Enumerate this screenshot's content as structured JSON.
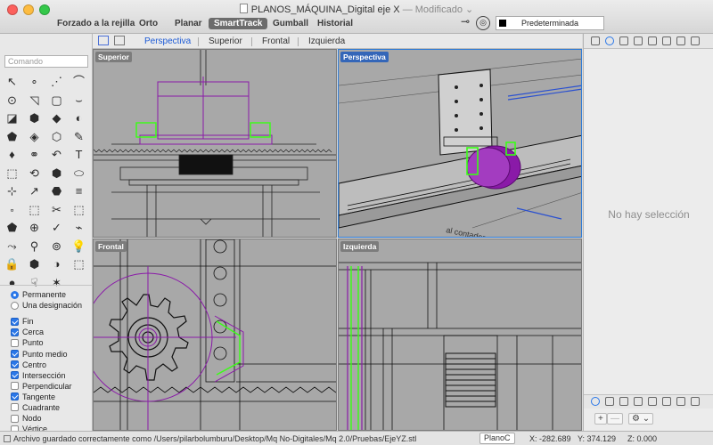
{
  "window": {
    "title": "PLANOS_MÁQUINA_Digital eje X",
    "modified": "— Modificado",
    "modified_arrow": "⌄"
  },
  "toolbar": {
    "buttons": [
      "Forzado a la rejilla",
      "Orto",
      "Planar",
      "SmartTrack",
      "Gumball",
      "Historial"
    ],
    "active": "SmartTrack",
    "layer_name": "Predeterminada"
  },
  "viewport_tabs": {
    "tabs": [
      "Perspectiva",
      "Superior",
      "Frontal",
      "Izquierda"
    ],
    "active": "Perspectiva"
  },
  "viewports": {
    "superior": "Superior",
    "perspectiva": "Perspectiva",
    "frontal": "Frontal",
    "izquierda": "Izquierda"
  },
  "command": {
    "placeholder": "Comando"
  },
  "tools": [
    "↖",
    "∘",
    "⋰",
    "⌒",
    "⊙",
    "◹",
    "▢",
    "⌣",
    "◪",
    "⬢",
    "◆",
    "◐",
    "⬟",
    "◈",
    "⬡",
    "✎",
    "♦",
    "⚭",
    "↶",
    "T",
    "⬚",
    "⟲",
    "⬢",
    "⬭",
    "⊹",
    "↗",
    "⬣",
    "≡",
    "⬞",
    "⬚",
    "✂",
    "⬚",
    "⬟",
    "⊕",
    "✓",
    "⌁",
    "⤳",
    "⚲",
    "⊚",
    "💡",
    "🔒",
    "⬢",
    "◑",
    "⬚",
    "●",
    "☟",
    "✶",
    ""
  ],
  "osnap": {
    "mode_options": [
      {
        "label": "Permanente",
        "selected": true
      },
      {
        "label": "Una designación",
        "selected": false
      }
    ],
    "items": [
      {
        "label": "Fin",
        "checked": true
      },
      {
        "label": "Cerca",
        "checked": true
      },
      {
        "label": "Punto",
        "checked": false
      },
      {
        "label": "Punto medio",
        "checked": true
      },
      {
        "label": "Centro",
        "checked": true
      },
      {
        "label": "Intersección",
        "checked": true
      },
      {
        "label": "Perpendicular",
        "checked": false
      },
      {
        "label": "Tangente",
        "checked": true
      },
      {
        "label": "Cuadrante",
        "checked": false
      },
      {
        "label": "Nodo",
        "checked": false
      },
      {
        "label": "Vértice",
        "checked": false
      }
    ]
  },
  "properties": {
    "empty_text": "No hay selección",
    "add_label": "+",
    "minus_label": "—",
    "settings_label": "⚙ ⌄"
  },
  "status": {
    "message": "Archivo guardado correctamente como /Users/pilarbolumburu/Desktop/Mq No-Digitales/Mq 2.0/Pruebas/EjeYZ.stl",
    "cplane": "PlanoC",
    "x": "X: -282.689",
    "y": "Y: 374.129",
    "z": "Z: 0.000"
  },
  "colors": {
    "accent": "#2a77e8",
    "selection_purple": "#8a1aa8",
    "highlight_green": "#39ff14",
    "viewport_bg": "#a8a8a8"
  }
}
